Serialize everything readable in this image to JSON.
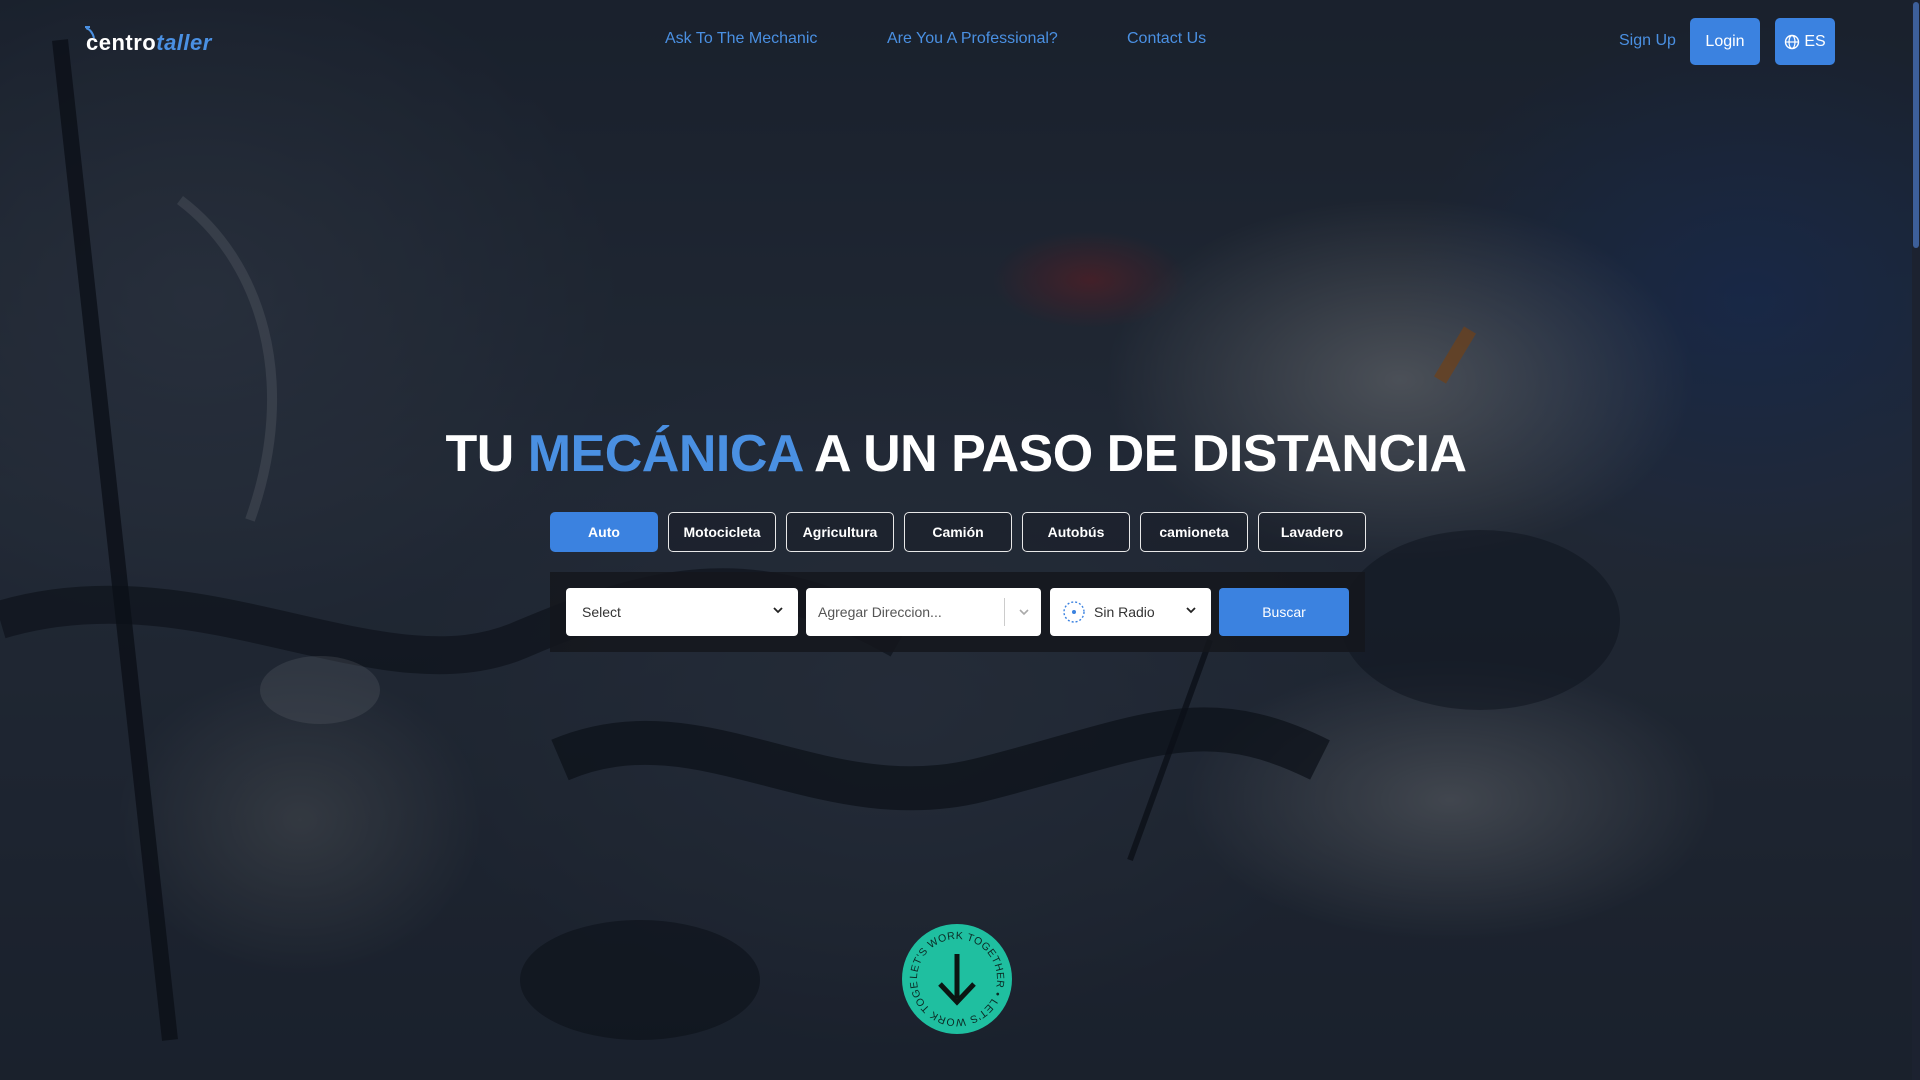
{
  "header": {
    "logo_part1": "centro",
    "logo_part2": "taller",
    "nav": [
      {
        "label": "Ask To The Mechanic"
      },
      {
        "label": "Are You A Professional?"
      },
      {
        "label": "Contact Us"
      }
    ],
    "signup_label": "Sign Up",
    "login_label": "Login",
    "language_label": "ES",
    "language_icon": "globe-icon"
  },
  "hero": {
    "title_part1": "TU",
    "title_accent": "MECÁNICA",
    "title_part2": "A UN PASO DE DISTANCIA",
    "accent_color": "#4a90e2"
  },
  "vehicle_tabs": [
    {
      "label": "Auto",
      "active": true
    },
    {
      "label": "Motocicleta",
      "active": false
    },
    {
      "label": "Agricultura",
      "active": false
    },
    {
      "label": "Camión",
      "active": false
    },
    {
      "label": "Autobús",
      "active": false
    },
    {
      "label": "camioneta",
      "active": false
    },
    {
      "label": "Lavadero",
      "active": false
    }
  ],
  "search": {
    "service_select_value": "Select",
    "address_placeholder": "Agregar Direccion...",
    "radius_value": "Sin Radio",
    "radius_icon": "radius-circle-icon",
    "submit_label": "Buscar"
  },
  "scroll_badge": {
    "ring_text": "LET'S WORK TOGETHER • LET'S WORK TOGETHER •",
    "icon": "arrow-down-icon",
    "color": "#1fbfa0"
  },
  "colors": {
    "brand_blue": "#3b82e0",
    "link_blue": "#4a90e2"
  }
}
